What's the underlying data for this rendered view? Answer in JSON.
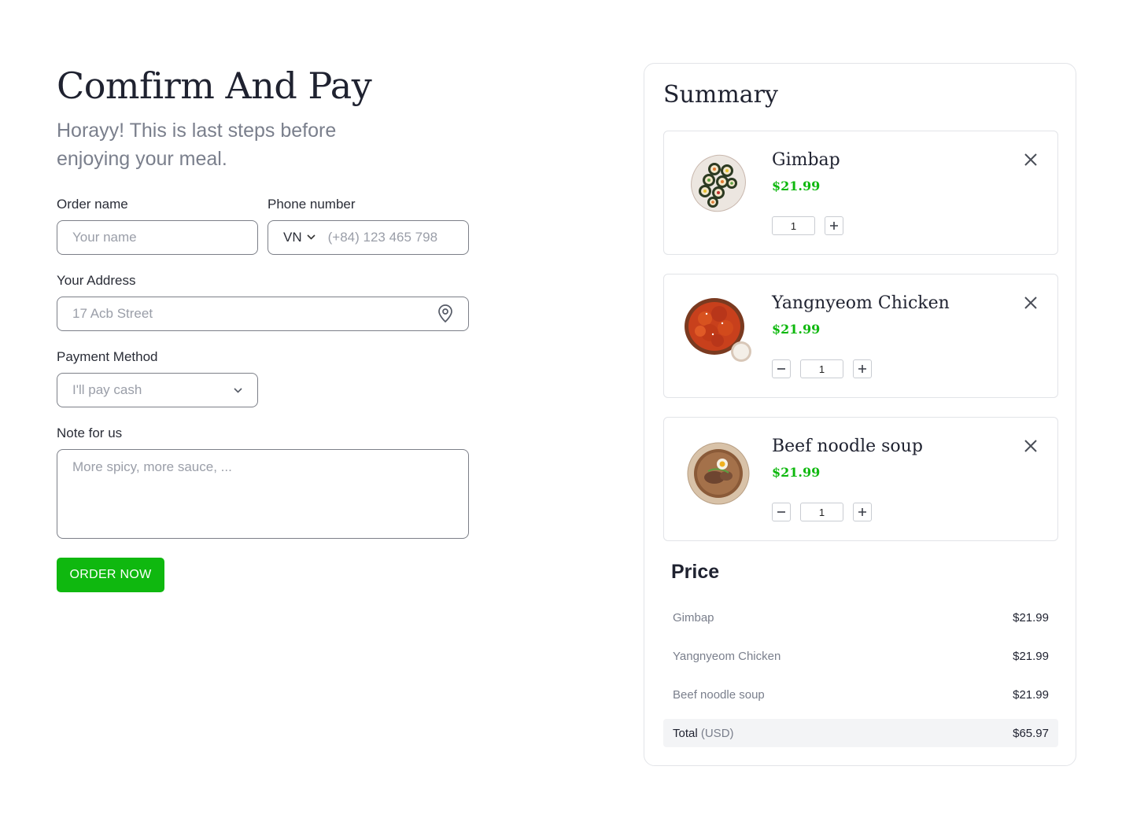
{
  "checkout": {
    "title": "Comfirm And Pay",
    "subtitle": "Horayy! This is last steps before enjoying your meal.",
    "order_name_label": "Order name",
    "order_name_placeholder": "Your name",
    "phone_label": "Phone number",
    "country_code": "VN",
    "phone_placeholder": "(+84) 123 465 798",
    "address_label": "Your Address",
    "address_placeholder": "17 Acb Street",
    "payment_label": "Payment Method",
    "payment_selected": "I'll pay cash",
    "note_label": "Note for us",
    "note_placeholder": "More spicy, more sauce, ...",
    "order_button": "ORDER NOW"
  },
  "summary": {
    "title": "Summary",
    "items": [
      {
        "name": "Gimbap",
        "price": "$21.99",
        "quantity": "1",
        "image_icon": "gimbap-plate-icon"
      },
      {
        "name": "Yangnyeom Chicken",
        "price": "$21.99",
        "quantity": "1",
        "image_icon": "chicken-plate-icon"
      },
      {
        "name": "Beef noodle soup",
        "price": "$21.99",
        "quantity": "1",
        "image_icon": "noodle-bowl-icon"
      }
    ]
  },
  "price": {
    "title": "Price",
    "lines": [
      {
        "name": "Gimbap",
        "value": "$21.99"
      },
      {
        "name": "Yangnyeom Chicken",
        "value": "$21.99"
      },
      {
        "name": "Beef noodle soup",
        "value": "$21.99"
      }
    ],
    "total_label": "Total",
    "total_unit": "(USD)",
    "total_value": "$65.97"
  },
  "colors": {
    "accent_green": "#0fb80f",
    "text_dark": "#1f2230",
    "text_muted": "#7a7f8c",
    "border": "#e2e4e8"
  }
}
